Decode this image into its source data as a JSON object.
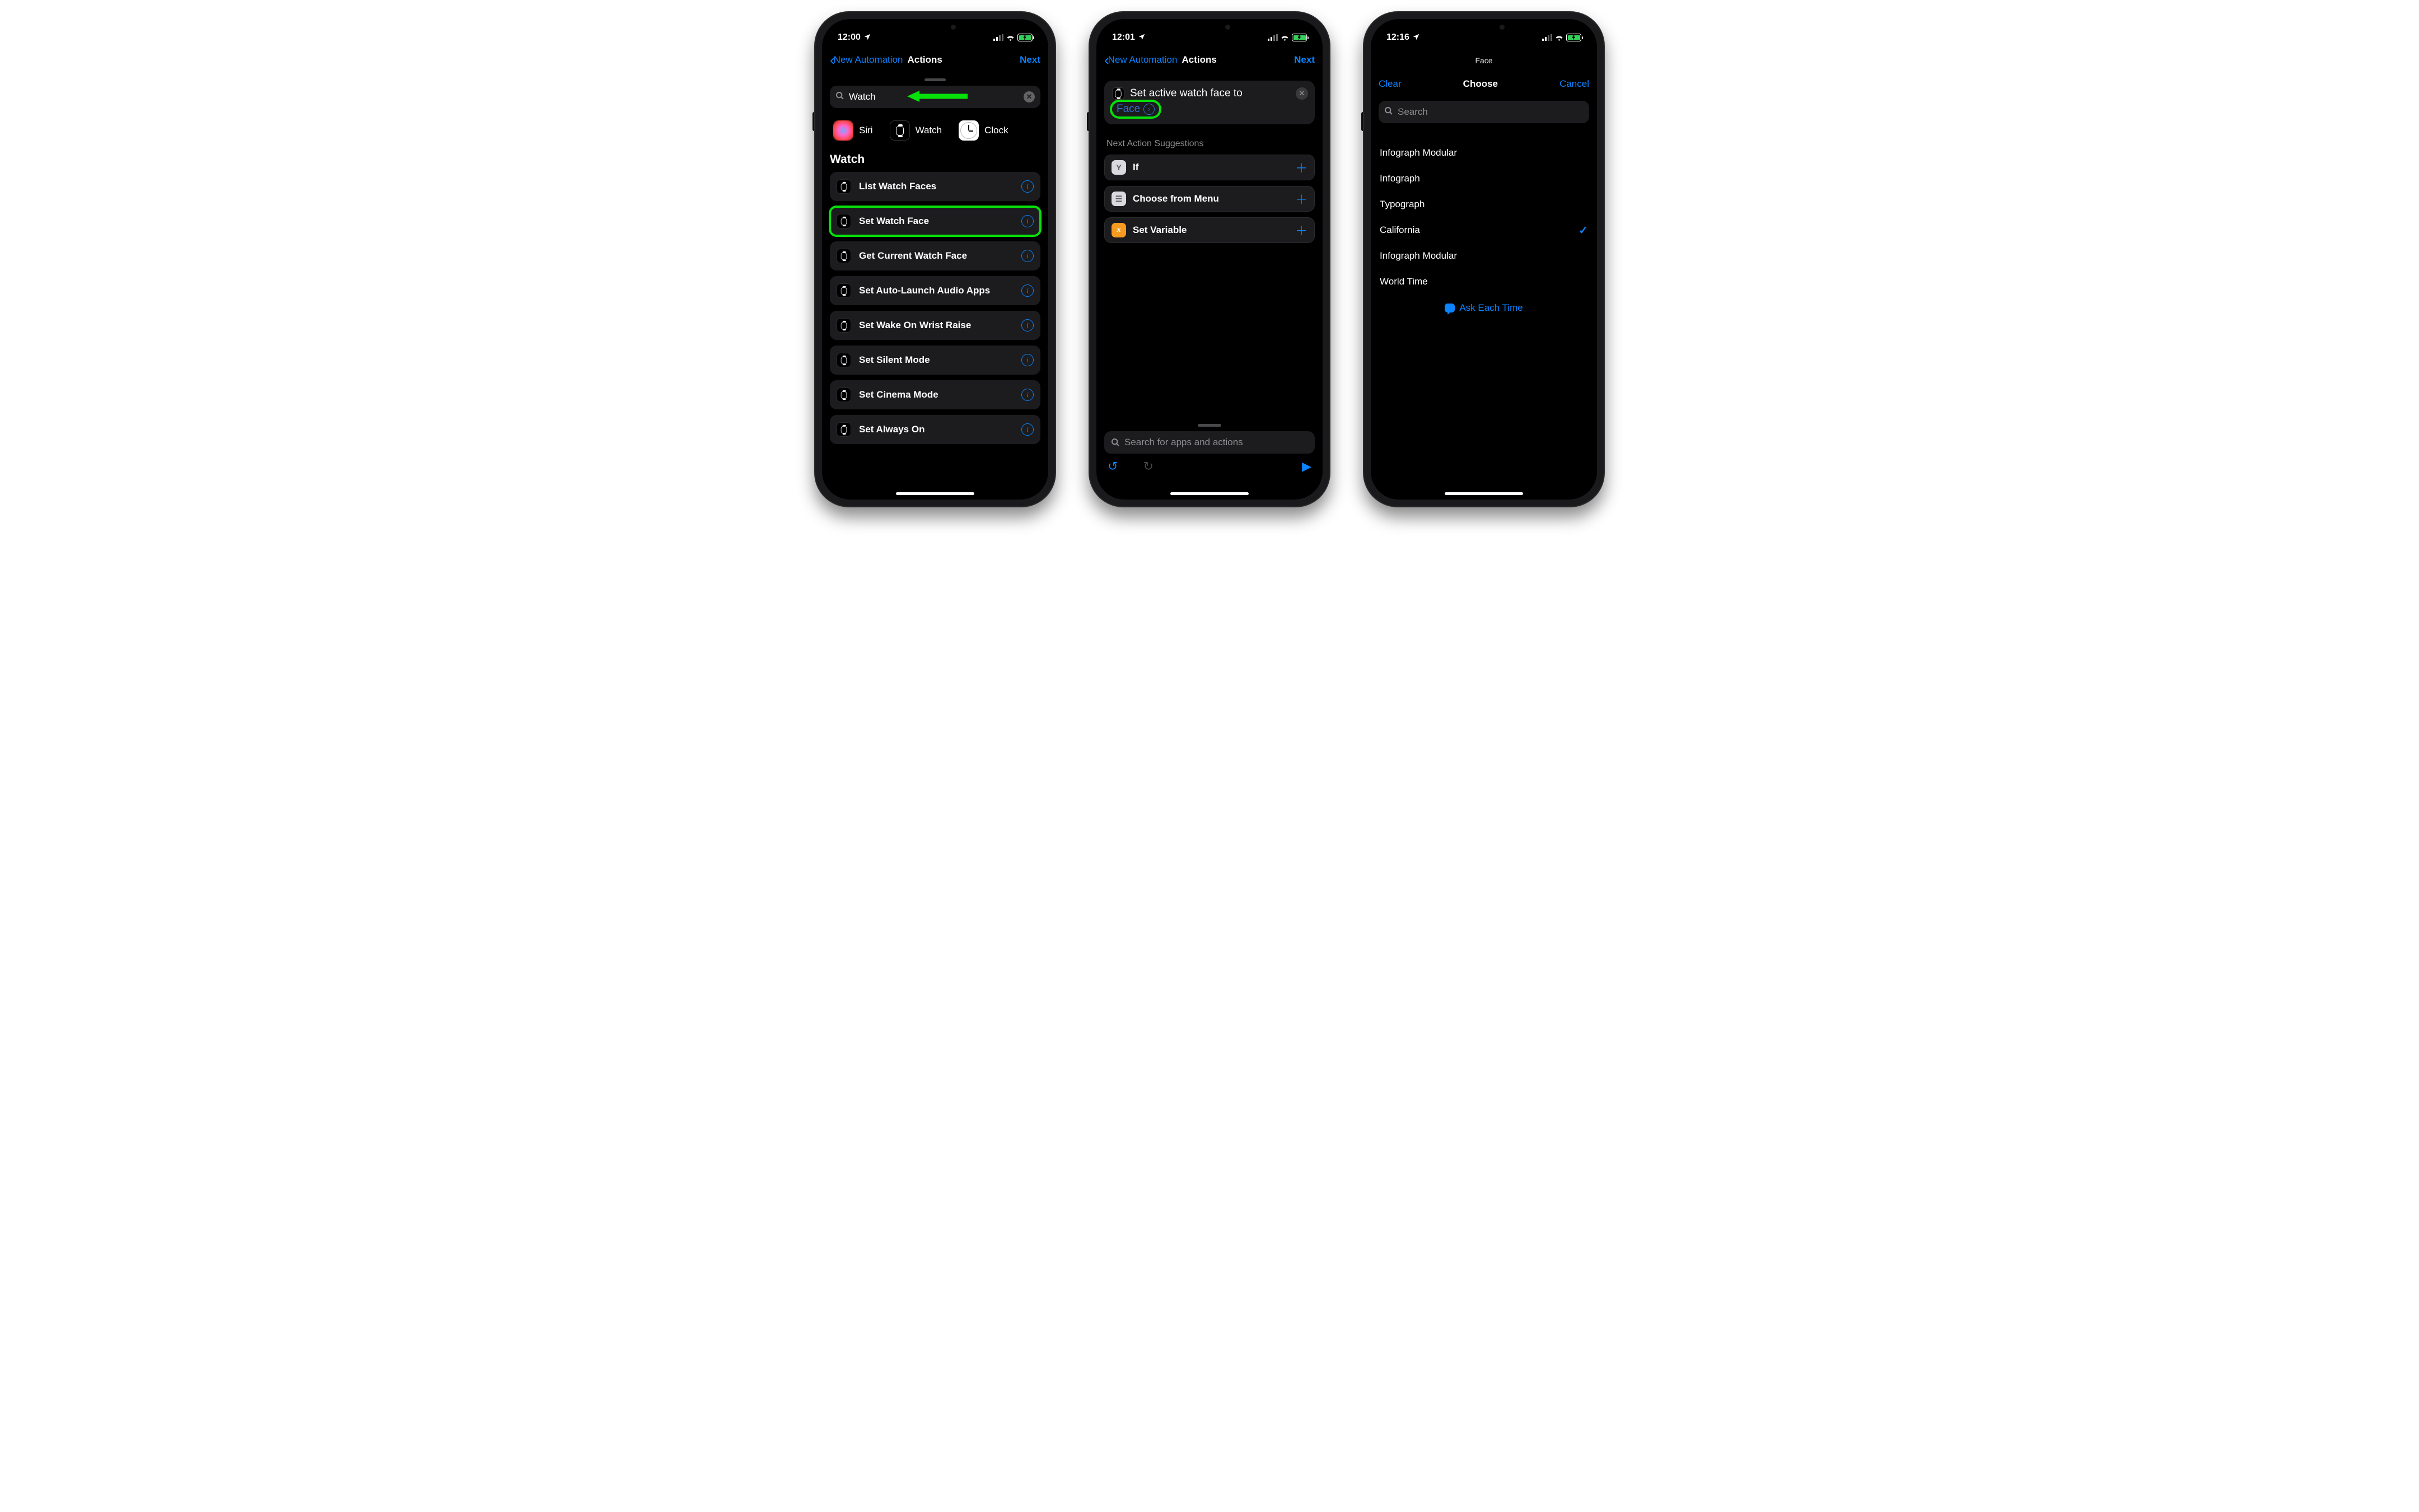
{
  "accent": "#0a84ff",
  "highlight": "#06e10a",
  "screen1": {
    "time": "12:00",
    "nav": {
      "back": "New Automation",
      "title": "Actions",
      "next": "Next"
    },
    "search_value": "Watch",
    "apps": [
      {
        "name": "Siri"
      },
      {
        "name": "Watch"
      },
      {
        "name": "Clock"
      }
    ],
    "section": "Watch",
    "actions": [
      {
        "label": "List Watch Faces",
        "highlight": false
      },
      {
        "label": "Set Watch Face",
        "highlight": true
      },
      {
        "label": "Get Current Watch Face",
        "highlight": false
      },
      {
        "label": "Set Auto-Launch Audio Apps",
        "highlight": false
      },
      {
        "label": "Set Wake On Wrist Raise",
        "highlight": false
      },
      {
        "label": "Set Silent Mode",
        "highlight": false
      },
      {
        "label": "Set Cinema Mode",
        "highlight": false
      },
      {
        "label": "Set Always On",
        "highlight": false
      }
    ]
  },
  "screen2": {
    "time": "12:01",
    "nav": {
      "back": "New Automation",
      "title": "Actions",
      "next": "Next"
    },
    "card": {
      "prefix": "Set active watch face to",
      "param": "Face"
    },
    "suggestions_header": "Next Action Suggestions",
    "suggestions": [
      {
        "label": "If",
        "kind": "if"
      },
      {
        "label": "Choose from Menu",
        "kind": "menu"
      },
      {
        "label": "Set Variable",
        "kind": "var"
      }
    ],
    "search_placeholder": "Search for apps and actions"
  },
  "screen3": {
    "time": "12:16",
    "header_small": "Face",
    "clear": "Clear",
    "title": "Choose",
    "cancel": "Cancel",
    "search_placeholder": "Search",
    "options": [
      {
        "label": "Infograph Modular",
        "selected": false
      },
      {
        "label": "Infograph",
        "selected": false
      },
      {
        "label": "Typograph",
        "selected": false
      },
      {
        "label": "California",
        "selected": true
      },
      {
        "label": "Infograph Modular",
        "selected": false
      },
      {
        "label": "World Time",
        "selected": false
      }
    ],
    "ask": "Ask Each Time"
  }
}
